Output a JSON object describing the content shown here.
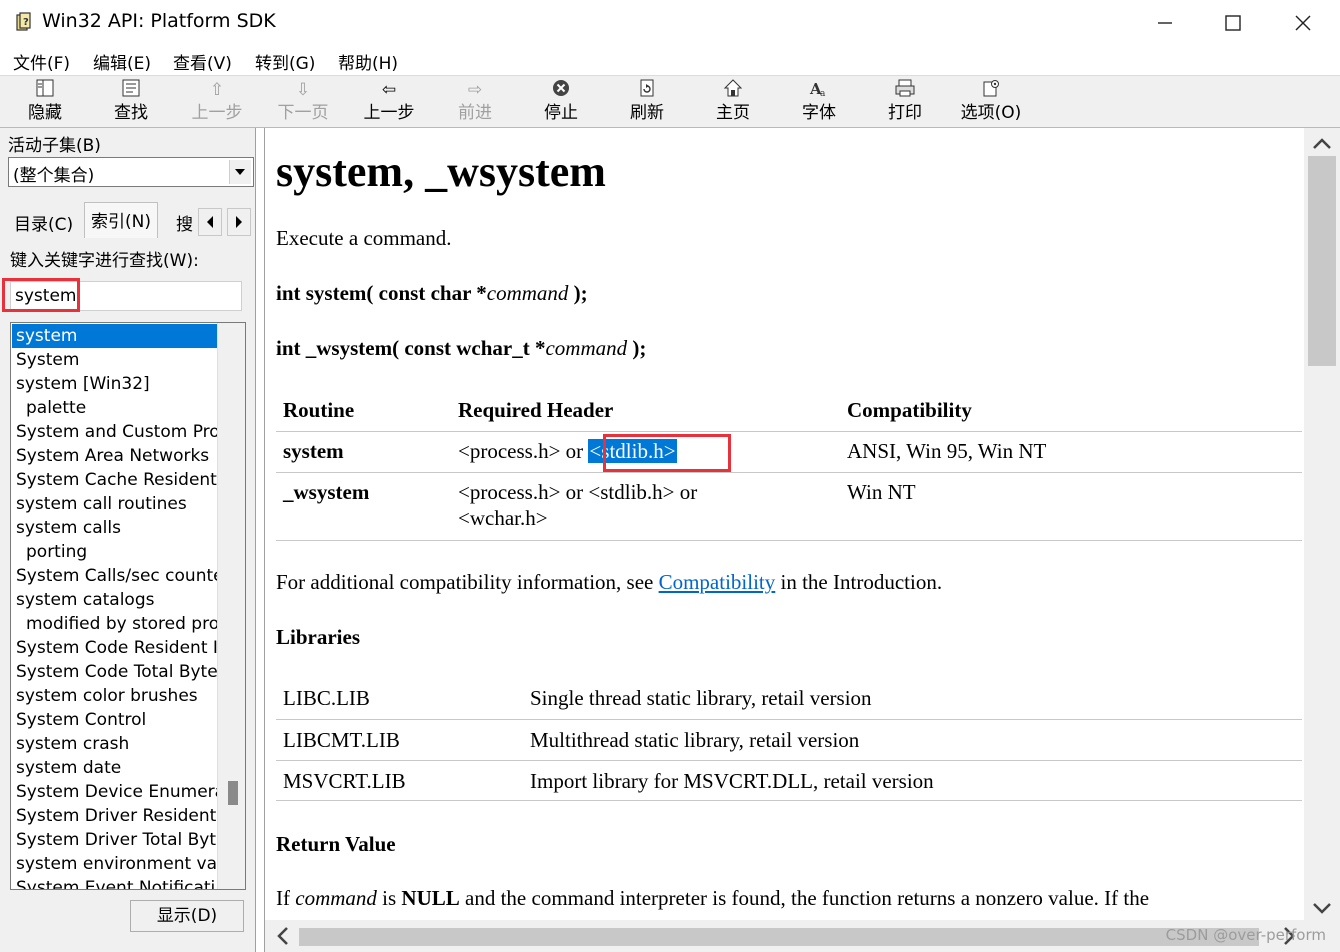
{
  "window": {
    "title": "Win32 API: Platform SDK",
    "icon": "help-book-icon"
  },
  "menu": [
    "文件(F)",
    "编辑(E)",
    "查看(V)",
    "转到(G)",
    "帮助(H)"
  ],
  "toolbar": {
    "hide": "隐藏",
    "find": "查找",
    "prev_step_disabled": "上一步",
    "next_page_disabled": "下一页",
    "back": "上一步",
    "forward": "前进",
    "stop": "停止",
    "refresh": "刷新",
    "home": "主页",
    "font": "字体",
    "print": "打印",
    "options": "选项(O)"
  },
  "left": {
    "subset_label": "活动子集(B)",
    "subset_value": "(整个集合)",
    "tabs": [
      "目录(C)",
      "索引(N)",
      "搜"
    ],
    "keyword_label": "键入关键字进行查找(W):",
    "keyword_value": "system",
    "index_items": [
      {
        "text": "system",
        "sub": false,
        "selected": true
      },
      {
        "text": "System",
        "sub": false,
        "selected": false
      },
      {
        "text": "system [Win32]",
        "sub": false,
        "selected": false
      },
      {
        "text": "palette",
        "sub": true,
        "selected": false
      },
      {
        "text": "System and Custom Pro",
        "sub": false,
        "selected": false
      },
      {
        "text": "System Area Networks",
        "sub": false,
        "selected": false
      },
      {
        "text": "System Cache Resident",
        "sub": false,
        "selected": false
      },
      {
        "text": "system call routines",
        "sub": false,
        "selected": false
      },
      {
        "text": "system calls",
        "sub": false,
        "selected": false
      },
      {
        "text": "porting",
        "sub": true,
        "selected": false
      },
      {
        "text": "System Calls/sec counte",
        "sub": false,
        "selected": false
      },
      {
        "text": "system catalogs",
        "sub": false,
        "selected": false
      },
      {
        "text": "modified by stored pro",
        "sub": true,
        "selected": false
      },
      {
        "text": "System Code Resident I",
        "sub": false,
        "selected": false
      },
      {
        "text": "System Code Total Byte",
        "sub": false,
        "selected": false
      },
      {
        "text": "system color brushes",
        "sub": false,
        "selected": false
      },
      {
        "text": "System Control",
        "sub": false,
        "selected": false
      },
      {
        "text": "system crash",
        "sub": false,
        "selected": false
      },
      {
        "text": "system date",
        "sub": false,
        "selected": false
      },
      {
        "text": "System Device Enumera",
        "sub": false,
        "selected": false
      },
      {
        "text": "System Driver Resident",
        "sub": false,
        "selected": false
      },
      {
        "text": "System Driver Total Byt",
        "sub": false,
        "selected": false
      },
      {
        "text": "system environment var",
        "sub": false,
        "selected": false
      },
      {
        "text": "System Event Notificati",
        "sub": false,
        "selected": false
      }
    ],
    "display_button": "显示(D)"
  },
  "doc": {
    "title": "system, _wsystem",
    "description": "Execute a command.",
    "proto1": {
      "prefix": "int system( const char *",
      "param": "command",
      "suffix": " );"
    },
    "proto2": {
      "prefix": "int _wsystem( const wchar_t *",
      "param": "command",
      "suffix": " );"
    },
    "req_headers": [
      "Routine",
      "Required Header",
      "Compatibility"
    ],
    "req_rows": [
      {
        "routine": "system",
        "header_a": "<process.h> or ",
        "header_sel": "<stdlib.h>",
        "header_b": "",
        "compat": "ANSI, Win 95, Win NT"
      },
      {
        "routine": "_wsystem",
        "header_a": "<process.h> or <stdlib.h> or",
        "header_sel": "",
        "header_b": "<wchar.h>",
        "compat": "Win NT"
      }
    ],
    "compat_prefix": "For additional compatibility information, see ",
    "compat_link": "Compatibility",
    "compat_suffix": " in the Introduction.",
    "libraries_heading": "Libraries",
    "libraries": [
      {
        "name": "LIBC.LIB",
        "desc": "Single thread static library, retail version"
      },
      {
        "name": "LIBCMT.LIB",
        "desc": "Multithread static library, retail version"
      },
      {
        "name": "MSVCRT.LIB",
        "desc": "Import library for MSVCRT.DLL, retail version"
      }
    ],
    "return_heading": "Return Value",
    "return_text": {
      "a": "If ",
      "b": "command",
      "c": " is ",
      "d": "NULL",
      "e": " and the command interpreter is found, the function returns a nonzero value. If the"
    }
  },
  "watermark": "CSDN @over-perform"
}
